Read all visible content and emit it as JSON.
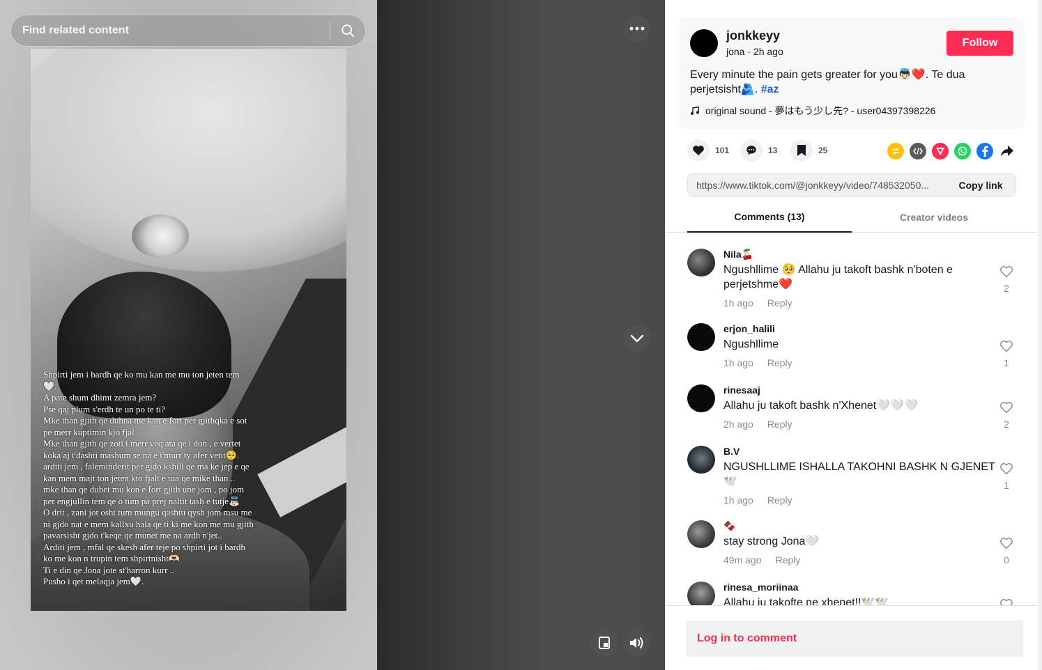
{
  "search": {
    "placeholder": "Find related content"
  },
  "video": {
    "caption": "Shpirti jem i bardh qe ko mu kan me mu ton jeten tem\n🤍.\nA pate shum dhimt zemra jem?\nPse qaj plum s'erdh te un po te ti?\nMke than gjith qe duhna me kan e fort per gjithqka e sot\npe merr kuptimin kjo fjal .\nMke than gjith qe zoti i merr veq ata qe i don , e vertet\nkoka aj t'dashti mashum se na e t'murr ty afer vetit🥺.\narditi jem , faleminderit per gjdo kshill qe ma ke jep e qe\nkan mem majt ton jeten kto fjalt e tua qe mike than ..\nmke than qe duhet mu kon e fort gjith une jom , po jom\nper engjullin tem qe o tum pa prej naltit tash e tutje👼🏻\nO drit , zani jot osht tum mungu qashtu qysh jom msu me\nni gjdo nat e mem kallxu hala qe ti ki me kon me mu gjith\npavarsisht gjdo t'keqe qe munet me na ardh n'jet..\nArditi jem , mfal qe skesh afer teje po shpirti jot i bardh\nko me kon n trupin tem shpirtnisht🫶🏻\nTi e din qe Jona jote st'harron kurr ..\nPusho i qet melaqja jem🤍."
  },
  "author": {
    "username": "jonkkeyy",
    "nickname": "jona",
    "separator": " · ",
    "time": "2h ago",
    "follow_label": "Follow"
  },
  "post": {
    "description": "Every minute the pain gets greater for you👼🏻❤️. Te dua perjetsisht🫂. ",
    "hashtag": "#az",
    "music": "original sound - 夢はもう少し先? - user04397398226"
  },
  "stats": {
    "likes": "101",
    "comments": "13",
    "saves": "25"
  },
  "share": {
    "link": "https://www.tiktok.com/@jonkkeyy/video/748532050...",
    "copy_label": "Copy link",
    "icons": [
      "repost-icon",
      "embed-icon",
      "send-icon",
      "whatsapp-icon",
      "facebook-icon",
      "share-arrow-icon"
    ]
  },
  "tabs": {
    "comments": "Comments (13)",
    "creator": "Creator videos"
  },
  "comments": [
    {
      "user": "Nila🍒",
      "text": "Ngushllime 🥺 Allahu ju takoft bashk n'boten e perjetshme❤️",
      "time": "1h ago",
      "reply": "Reply",
      "likes": "2"
    },
    {
      "user": "erjon_halili",
      "text": "Ngushllime",
      "time": "1h ago",
      "reply": "Reply",
      "likes": "1"
    },
    {
      "user": "rinesaaj",
      "text": "Allahu ju takoft bashk n'Xhenet🤍🤍🤍",
      "time": "2h ago",
      "reply": "Reply",
      "likes": "2"
    },
    {
      "user": "B.V",
      "text": "NGUSHLLIME ISHALLA TAKOHNI BASHK N GJENET 🕊️",
      "time": "1h ago",
      "reply": "Reply",
      "likes": "1"
    },
    {
      "user": "🍫",
      "text": "stay strong Jona🤍",
      "time": "49m ago",
      "reply": "Reply",
      "likes": "0"
    },
    {
      "user": "rinesa_moriinaa",
      "text": "Allahu ju takofte ne xhenet!!🕊️🕊️",
      "time": "",
      "reply": "",
      "likes": ""
    }
  ],
  "footer": {
    "login_label": "Log in to comment"
  },
  "colors": {
    "accent": "#fe2c55",
    "hashtag": "#2b5db9"
  }
}
